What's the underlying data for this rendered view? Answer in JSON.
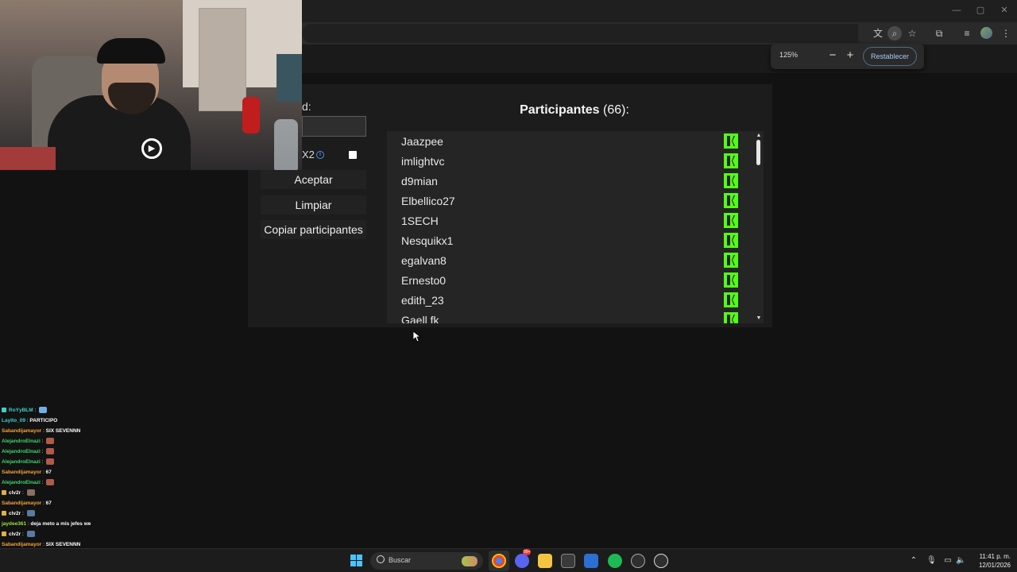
{
  "browser": {
    "zoom_level": "125%",
    "zoom_minus": "−",
    "zoom_plus": "+",
    "reset_label": "Restablecer"
  },
  "form": {
    "field_label": "d:",
    "x2_label": "X2",
    "accept_label": "Aceptar",
    "clear_label": "Limpiar",
    "copy_label": "Copiar participantes"
  },
  "participants": {
    "title": "Participantes",
    "count": "(66):",
    "items": [
      "Jaazpee",
      "imlightvc",
      "d9mian",
      "Elbellico27",
      "1SECH",
      "Nesquikx1",
      "egalvan8",
      "Ernesto0",
      "edith_23",
      "Gaell fk"
    ]
  },
  "chat": [
    {
      "user": "RoYyBLM",
      "msg": "",
      "color": "#3fd0c8",
      "badge": "#3fd0c8",
      "emote": "#6fb0e8"
    },
    {
      "user": "Layito_09",
      "msg": "PARTICIPO",
      "color": "#3fd0c8",
      "badge": "",
      "emote": ""
    },
    {
      "user": "Sabandijamayor",
      "msg": "SIX SEVENNN",
      "color": "#f2a33a",
      "badge": "",
      "emote": ""
    },
    {
      "user": "AlejandroElnazi",
      "msg": "",
      "color": "#3ad86a",
      "badge": "",
      "emote": "#b05a4a"
    },
    {
      "user": "AlejandroElnazi",
      "msg": "",
      "color": "#3ad86a",
      "badge": "",
      "emote": "#b05a4a"
    },
    {
      "user": "AlejandroElnazi",
      "msg": "",
      "color": "#3ad86a",
      "badge": "",
      "emote": "#b05a4a"
    },
    {
      "user": "Sabandijamayor",
      "msg": "67",
      "color": "#f2a33a",
      "badge": "",
      "emote": ""
    },
    {
      "user": "AlejandroElnazi",
      "msg": "",
      "color": "#3ad86a",
      "badge": "",
      "emote": "#b05a4a"
    },
    {
      "user": "clv2r",
      "msg": "",
      "color": "#ffffff",
      "badge": "#e0b040",
      "emote": "#8a7060"
    },
    {
      "user": "Sabandijamayor",
      "msg": "67",
      "color": "#f2a33a",
      "badge": "",
      "emote": ""
    },
    {
      "user": "clv2r",
      "msg": "",
      "color": "#ffffff",
      "badge": "#e0b040",
      "emote": "#5a7aa0"
    },
    {
      "user": "jaydee361",
      "msg": "deja meto a mis jefes we",
      "color": "#9be04a",
      "badge": "",
      "emote": ""
    },
    {
      "user": "clv2r",
      "msg": "",
      "color": "#ffffff",
      "badge": "#e0b040",
      "emote": "#5a7aa0"
    },
    {
      "user": "Sabandijamayor",
      "msg": "SIX SEVENNN",
      "color": "#f2a33a",
      "badge": "",
      "emote": ""
    },
    {
      "user": "clv2r",
      "msg": "",
      "color": "#ffffff",
      "badge": "#e0b040",
      "emote": "#6a7a50"
    },
    {
      "user": "clv2r",
      "msg": "",
      "color": "#ffffff",
      "badge": "#e0b040",
      "emote": "#4ab060"
    }
  ],
  "taskbar": {
    "search_placeholder": "Buscar",
    "time": "11:41 p. m.",
    "date": "12/01/2026",
    "discord_badge": "99+"
  },
  "colors": {
    "kick_green": "#53fc18",
    "accent_blue": "#a8c7fa"
  }
}
